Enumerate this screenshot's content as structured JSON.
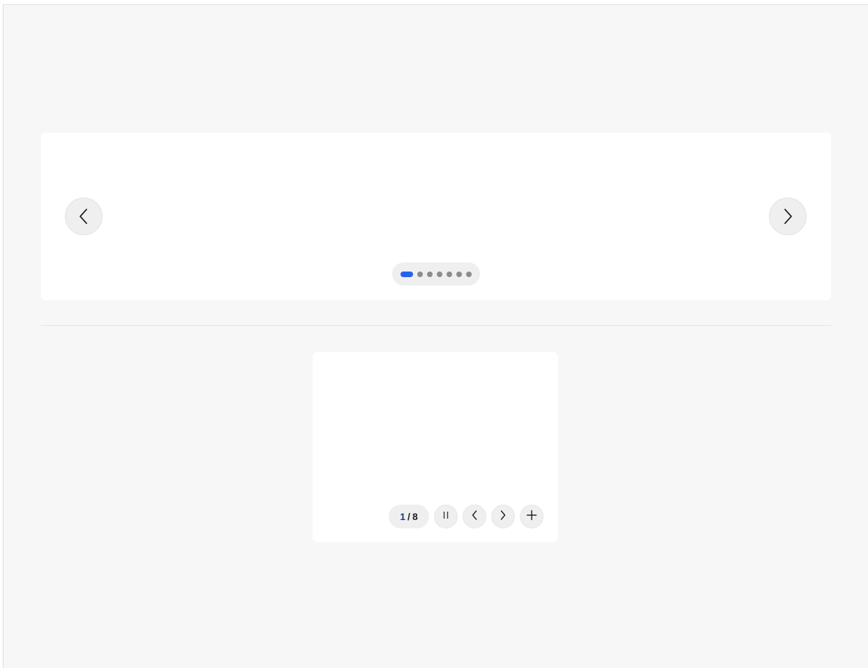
{
  "carousel": {
    "prev_icon": "chevron-left-icon",
    "next_icon": "chevron-right-icon",
    "slide_count": 7,
    "active_index": 0,
    "colors": {
      "active_dot": "#2563eb",
      "inactive_dot": "#8c8c8c"
    }
  },
  "compact_carousel": {
    "counter_current": "1",
    "counter_separator": "/",
    "counter_total": "8",
    "pause_icon": "pause-icon",
    "prev_icon": "chevron-left-icon",
    "next_icon": "chevron-right-icon",
    "add_icon": "plus-icon"
  }
}
